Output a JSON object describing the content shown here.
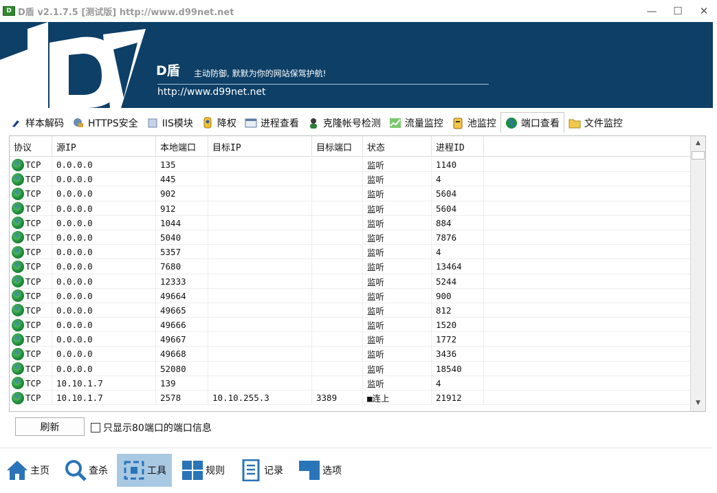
{
  "window": {
    "title": "D盾 v2.1.7.5 [测试版] http://www.d99net.net",
    "controls": [
      "—",
      "☐",
      "✕"
    ]
  },
  "banner": {
    "brand": "D盾",
    "tagline": "主动防御, 默默为你的网站保驾护航!",
    "url": "http://www.d99net.net",
    "bg_color": "#0d3f67"
  },
  "tabs": [
    {
      "label": "样本解码",
      "icon": "brush-icon"
    },
    {
      "label": "HTTPS安全",
      "icon": "globe-lock-icon"
    },
    {
      "label": "IIS模块",
      "icon": "module-icon"
    },
    {
      "label": "降权",
      "icon": "shield-user-icon"
    },
    {
      "label": "进程查看",
      "icon": "window-icon"
    },
    {
      "label": "克隆帐号检测",
      "icon": "user-clone-icon"
    },
    {
      "label": "流量监控",
      "icon": "chart-icon"
    },
    {
      "label": "池监控",
      "icon": "clipboard-icon"
    },
    {
      "label": "端口查看",
      "icon": "globe-icon",
      "active": true
    },
    {
      "label": "文件监控",
      "icon": "folder-icon"
    }
  ],
  "table": {
    "columns": [
      "协议",
      "源IP",
      "本地端口",
      "目标IP",
      "目标端口",
      "状态",
      "进程ID"
    ],
    "rows": [
      [
        "TCP",
        "0.0.0.0",
        "135",
        "",
        "",
        "监听",
        "1140"
      ],
      [
        "TCP",
        "0.0.0.0",
        "445",
        "",
        "",
        "监听",
        "4"
      ],
      [
        "TCP",
        "0.0.0.0",
        "902",
        "",
        "",
        "监听",
        "5604"
      ],
      [
        "TCP",
        "0.0.0.0",
        "912",
        "",
        "",
        "监听",
        "5604"
      ],
      [
        "TCP",
        "0.0.0.0",
        "1044",
        "",
        "",
        "监听",
        "884"
      ],
      [
        "TCP",
        "0.0.0.0",
        "5040",
        "",
        "",
        "监听",
        "7876"
      ],
      [
        "TCP",
        "0.0.0.0",
        "5357",
        "",
        "",
        "监听",
        "4"
      ],
      [
        "TCP",
        "0.0.0.0",
        "7680",
        "",
        "",
        "监听",
        "13464"
      ],
      [
        "TCP",
        "0.0.0.0",
        "12333",
        "",
        "",
        "监听",
        "5244"
      ],
      [
        "TCP",
        "0.0.0.0",
        "49664",
        "",
        "",
        "监听",
        "900"
      ],
      [
        "TCP",
        "0.0.0.0",
        "49665",
        "",
        "",
        "监听",
        "812"
      ],
      [
        "TCP",
        "0.0.0.0",
        "49666",
        "",
        "",
        "监听",
        "1520"
      ],
      [
        "TCP",
        "0.0.0.0",
        "49667",
        "",
        "",
        "监听",
        "1772"
      ],
      [
        "TCP",
        "0.0.0.0",
        "49668",
        "",
        "",
        "监听",
        "3436"
      ],
      [
        "TCP",
        "0.0.0.0",
        "52080",
        "",
        "",
        "监听",
        "18540"
      ],
      [
        "TCP",
        "10.10.1.7",
        "139",
        "",
        "",
        "监听",
        "4"
      ],
      [
        "TCP",
        "10.10.1.7",
        "2578",
        "10.10.255.3",
        "3389",
        "■连上",
        "21912"
      ]
    ]
  },
  "controls": {
    "refresh_label": "刷新",
    "checkbox_label": "只显示80端口的端口信息",
    "checkbox_checked": false
  },
  "nav": [
    {
      "label": "主页",
      "icon": "home-icon"
    },
    {
      "label": "查杀",
      "icon": "search-icon"
    },
    {
      "label": "工具",
      "icon": "tools-icon",
      "active": true
    },
    {
      "label": "规则",
      "icon": "grid-icon"
    },
    {
      "label": "记录",
      "icon": "document-icon"
    },
    {
      "label": "选项",
      "icon": "options-icon"
    }
  ],
  "colors": {
    "accent": "#2a74b8",
    "nav_active": "#a9c9e3"
  }
}
